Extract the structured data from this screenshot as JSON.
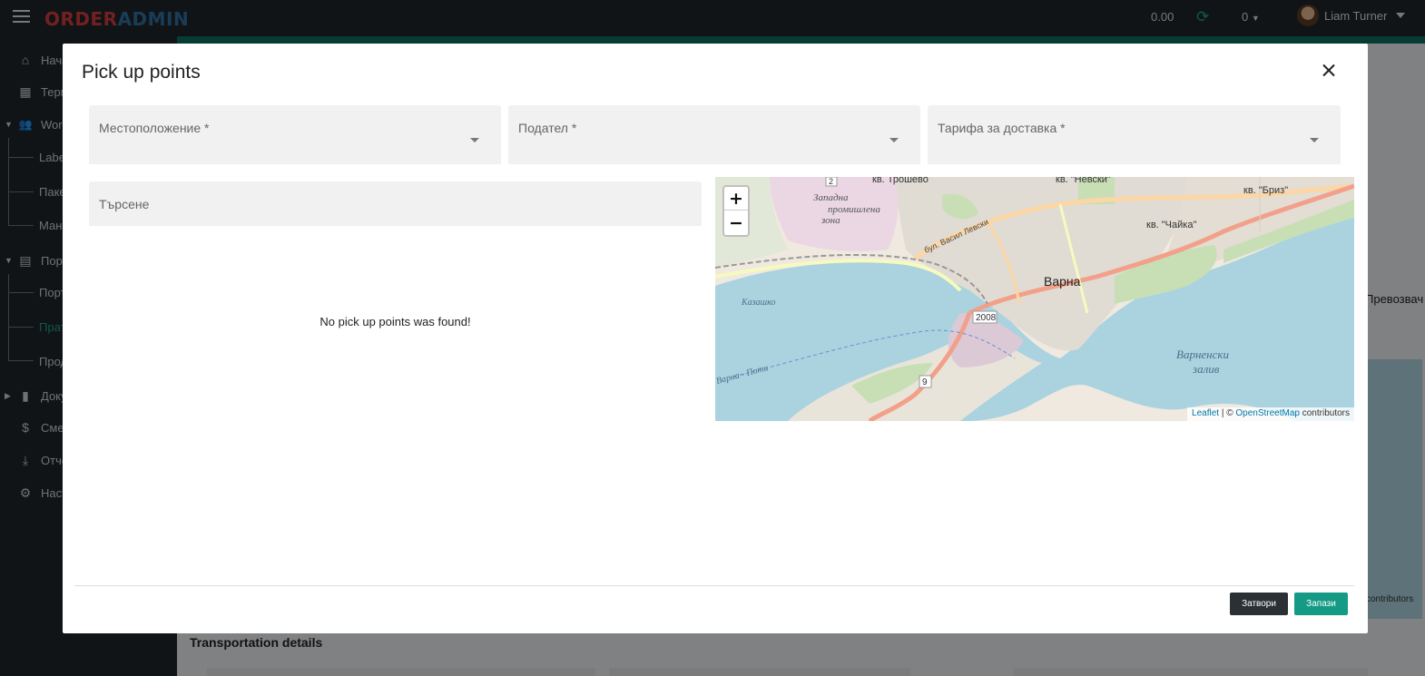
{
  "app": {
    "logo_order": "ORDER",
    "logo_admin": "ADMIN",
    "balance": "0.00",
    "notifications": "0",
    "user_name": "Liam Turner"
  },
  "sidebar": {
    "items": [
      {
        "label": "Нача",
        "icon": "home-icon"
      },
      {
        "label": "Терм",
        "icon": "qr-grid-icon"
      },
      {
        "label": "Work",
        "icon": "users-icon"
      },
      {
        "label": "Labe"
      },
      {
        "label": "Паке"
      },
      {
        "label": "Мана"
      },
      {
        "label": "Порт",
        "icon": "store-icon"
      },
      {
        "label": "Порт"
      },
      {
        "label": "Прат"
      },
      {
        "label": "Прод"
      },
      {
        "label": "Доку",
        "icon": "document-icon"
      },
      {
        "label": "Смет",
        "icon": "dollar-icon"
      },
      {
        "label": "Отче",
        "icon": "download-icon"
      },
      {
        "label": "Наст",
        "icon": "gear-icon"
      }
    ]
  },
  "background": {
    "right_label": "Превозвач",
    "right_contributors": "contributors",
    "bottom_title": "Transportation details"
  },
  "modal": {
    "title": "Pick up points",
    "fields": {
      "location_label": "Местоположение *",
      "sender_label": "Подател *",
      "tariff_label": "Тарифа за доставка *"
    },
    "search_placeholder": "Търсене",
    "empty_message": "No pick up points was found!",
    "map": {
      "zoom_in": "+",
      "zoom_out": "−",
      "attribution_leaflet": "Leaflet",
      "attribution_sep": " | © ",
      "attribution_osm": "OpenStreetMap",
      "attribution_tail": " contributors",
      "labels": {
        "city": "Варна",
        "bay_line1": "Варненски",
        "bay_line2": "залив",
        "zone_line1": "Западна",
        "zone_line2": "промишлена",
        "zone_line3": "зона",
        "district_troshevo": "кв. Трошево",
        "district_nevski": "кв. \"Невски\"",
        "district_briz": "кв. \"Бриз\"",
        "district_chaika": "кв. \"Чайка\"",
        "kazashko": "Казашко",
        "varna_poti": "Варна - Поти",
        "blvd": "бул. Васил Левски",
        "road_2008": "2008",
        "road_9": "9",
        "road_2": "2"
      }
    },
    "buttons": {
      "close": "Затвори",
      "save": "Запази"
    }
  },
  "colors": {
    "accent": "#159a85",
    "topbar": "#1f262b",
    "logo_red": "#cf3b3b",
    "logo_blue": "#2f6f9f"
  }
}
